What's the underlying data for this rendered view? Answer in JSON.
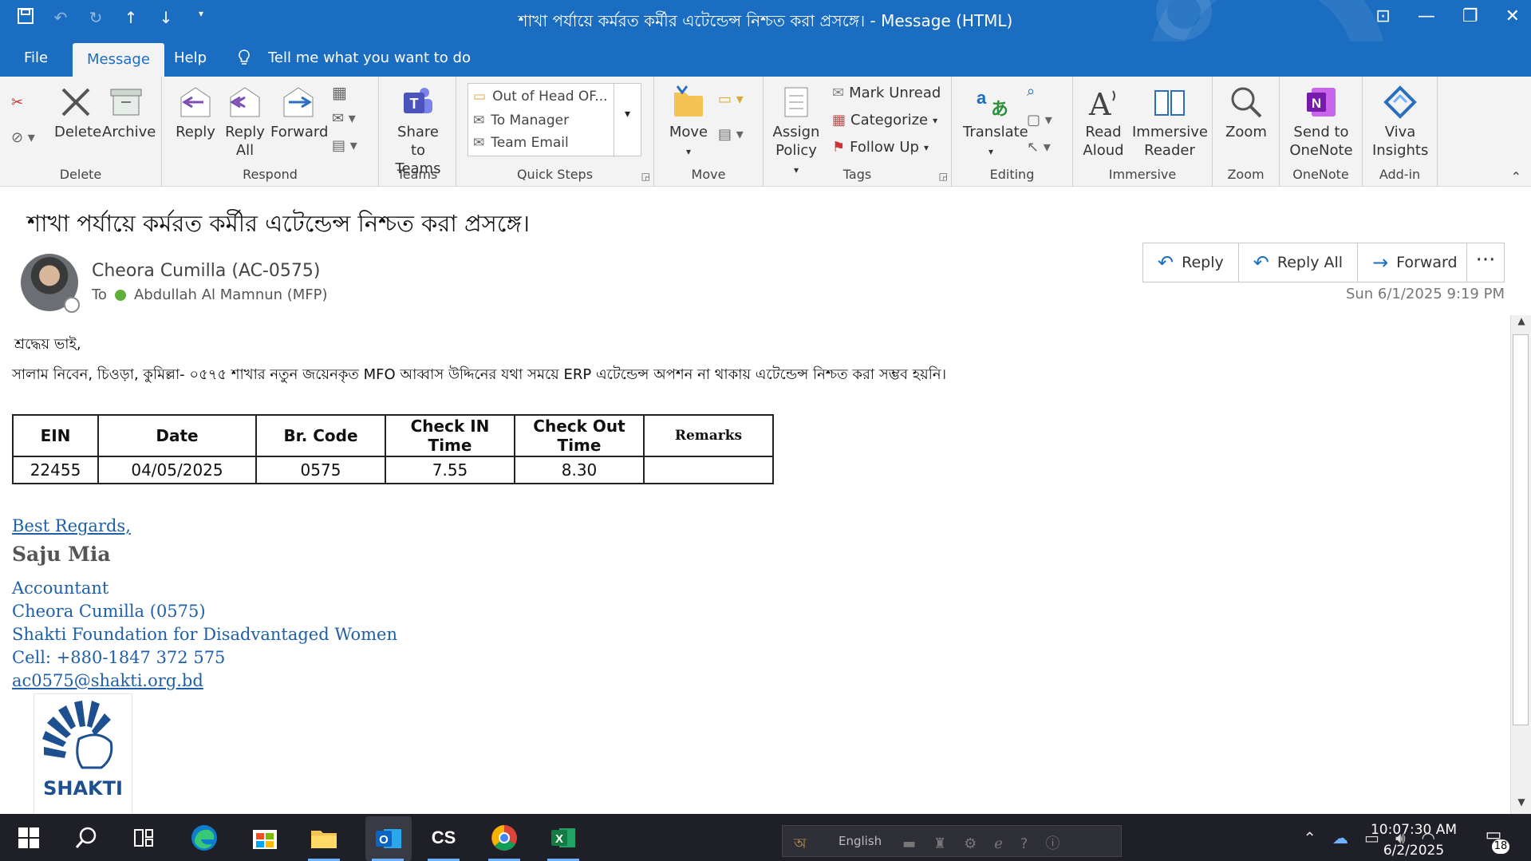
{
  "window": {
    "title": "শাখা পর্যায়ে কর্মরত কর্মীর এটেন্ডেন্স নিশ্চত করা প্রসঙ্গে। - Message (HTML)",
    "qat_icons": [
      "save-icon",
      "undo-icon",
      "redo-icon",
      "up-icon",
      "down-icon",
      "customize-icon"
    ]
  },
  "menu": {
    "file": "File",
    "message": "Message",
    "help": "Help",
    "tellme": "Tell me what you want to do"
  },
  "ribbon": {
    "delete_group": {
      "label": "Delete",
      "delete": "Delete",
      "archive": "Archive"
    },
    "respond_group": {
      "label": "Respond",
      "reply": "Reply",
      "reply_all_1": "Reply",
      "reply_all_2": "All",
      "forward": "Forward"
    },
    "teams_group": {
      "label": "Teams",
      "share_1": "Share to",
      "share_2": "Teams"
    },
    "quicksteps_group": {
      "label": "Quick Steps",
      "items": [
        "Out of Head OF...",
        "To Manager",
        "Team Email"
      ]
    },
    "move_group": {
      "label": "Move",
      "move": "Move"
    },
    "tags_group": {
      "label": "Tags",
      "assign_1": "Assign",
      "assign_2": "Policy",
      "mark_unread": "Mark Unread",
      "categorize": "Categorize",
      "follow_up": "Follow Up"
    },
    "editing_group": {
      "label": "Editing",
      "translate": "Translate"
    },
    "immersive_group": {
      "label": "Immersive",
      "read_1": "Read",
      "read_2": "Aloud",
      "reader_1": "Immersive",
      "reader_2": "Reader"
    },
    "zoom_group": {
      "label": "Zoom",
      "zoom": "Zoom"
    },
    "onenote_group": {
      "label": "OneNote",
      "send_1": "Send to",
      "send_2": "OneNote"
    },
    "addin_group": {
      "label": "Add-in",
      "viva_1": "Viva",
      "viva_2": "Insights"
    }
  },
  "message": {
    "subject": "শাখা পর্যায়ে কর্মরত কর্মীর এটেন্ডেন্স নিশ্চত করা প্রসঙ্গে।",
    "sender": "Cheora Cumilla (AC-0575)",
    "to_label": "To",
    "recipient": "Abdullah Al Mamnun (MFP)",
    "datetime": "Sun 6/1/2025 9:19 PM",
    "actions": {
      "reply": "Reply",
      "reply_all": "Reply All",
      "forward": "Forward",
      "more": "···"
    }
  },
  "body": {
    "greeting": "শ্রদ্ধেয় ভাই,",
    "paragraph": "সালাম নিবেন, চিওড়া, কুমিল্লা- ০৫৭৫ শাখার নতুন জয়েনকৃত MFO আব্বাস উদ্দিনের যথা সময়ে ERP এটেন্ডেন্স অপশন না থাকায় এটেন্ডেন্স নিশ্চত করা সম্ভব হয়নি।",
    "table": {
      "headers": [
        "EIN",
        "Date",
        "Br. Code",
        "Check IN Time",
        "Check Out Time",
        "Remarks"
      ],
      "rows": [
        [
          "22455",
          "04/05/2025",
          "0575",
          "7.55",
          "8.30",
          ""
        ]
      ]
    }
  },
  "signature": {
    "regards": "Best Regards,",
    "name": "Saju Mia",
    "title": "Accountant",
    "branch": "Cheora Cumilla (0575)",
    "org": "Shakti Foundation for Disadvantaged Women",
    "cell": "Cell: +880-1847 372 575",
    "email": "ac0575@shakti.org.bd",
    "logo_text": "SHAKTI"
  },
  "taskbar": {
    "language": "English",
    "time": "10:07:30 AM",
    "date": "6/2/2025",
    "notifications": "18",
    "cs_label": "CS"
  }
}
